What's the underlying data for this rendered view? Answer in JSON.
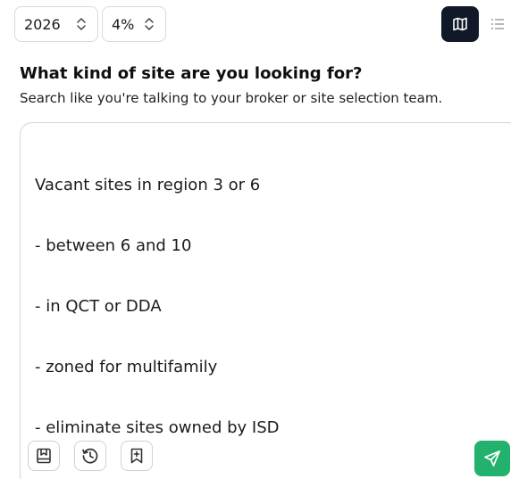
{
  "controls": {
    "year": "2026",
    "rate": "4%"
  },
  "icons": {
    "year_chevron": "chevron-up-down-icon",
    "rate_chevron": "chevron-up-down-icon",
    "map": "map-icon",
    "list": "list-icon",
    "save": "save-icon",
    "history": "history-icon",
    "bookmark_add": "bookmark-plus-icon",
    "send": "send-icon"
  },
  "colors": {
    "map_button_bg": "#111827",
    "send_button_bg": "#23b26d"
  },
  "heading": "What kind of site are you looking for?",
  "subheading": "Search like you're talking to your broker or site selection team.",
  "query": {
    "lines": [
      "Vacant sites in region 3 or 6",
      "- between 6 and 10",
      "- in QCT or DDA",
      "- zoned for multifamily",
      "- eliminate sites owned by ISD"
    ]
  }
}
